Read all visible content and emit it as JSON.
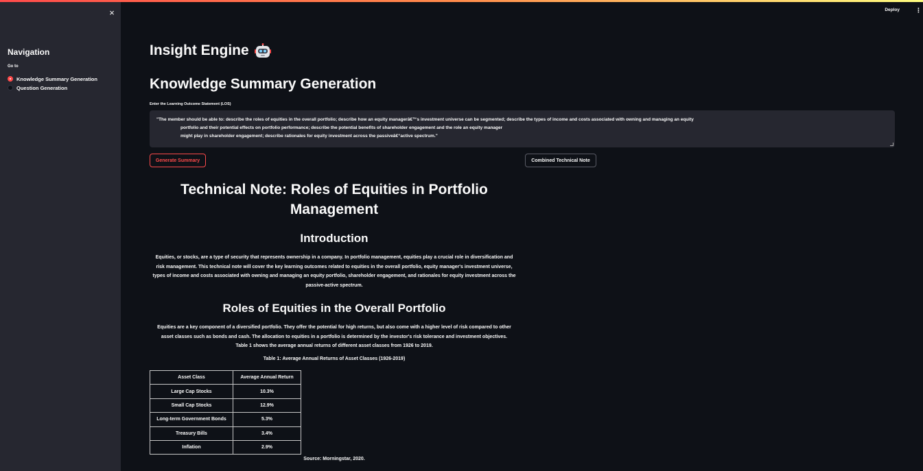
{
  "sidebar": {
    "close_glyph": "×",
    "title": "Navigation",
    "goto_label": "Go to",
    "options": [
      {
        "label": "Knowledge Summary Generation",
        "selected": true
      },
      {
        "label": "Question Generation",
        "selected": false
      }
    ]
  },
  "header": {
    "deploy_label": "Deploy",
    "menu_glyph": "⋮"
  },
  "main": {
    "app_title": "Insight Engine",
    "app_icon": "robot-face-icon",
    "page_title": "Knowledge Summary Generation",
    "los_label": "Enter the Learning Outcome Statement (LOS)",
    "los_lines": [
      "\"The member should be able to: describe the roles of equities in the overall portfolio; describe how an equity managerâ€™s investment universe can be segmented; describe the types of income and costs associated with owning and managing an equity",
      "portfolio and their potential effects on portfolio performance; describe the potential benefits of shareholder engagement and the role an equity manager",
      "might play in shareholder engagement; describe rationales for equity investment across the passiveâ€“active spectrum.\""
    ],
    "generate_button": "Generate Summary",
    "combined_button": "Combined Technical Note"
  },
  "note": {
    "title": "Technical Note: Roles of Equities in Portfolio Management",
    "intro_heading": "Introduction",
    "intro_text": "Equities, or stocks, are a type of security that represents ownership in a company. In portfolio management, equities play a crucial role in diversification and risk management. This technical note will cover the key learning outcomes related to equities in the overall portfolio, equity manager's investment universe, types of income and costs associated with owning and managing an equity portfolio, shareholder engagement, and rationales for equity investment across the passive-active spectrum.",
    "roles_heading": "Roles of Equities in the Overall Portfolio",
    "roles_text": "Equities are a key component of a diversified portfolio. They offer the potential for high returns, but also come with a higher level of risk compared to other asset classes such as bonds and cash. The allocation to equities in a portfolio is determined by the investor's risk tolerance and investment objectives. Table 1 shows the average annual returns of different asset classes from 1926 to 2019.",
    "table_caption": "Table 1: Average Annual Returns of Asset Classes (1926-2019)",
    "table_headers": [
      "Asset Class",
      "Average Annual Return"
    ],
    "table_rows": [
      [
        "Large Cap Stocks",
        "10.3%"
      ],
      [
        "Small Cap Stocks",
        "12.9%"
      ],
      [
        "Long-term Government Bonds",
        "5.3%"
      ],
      [
        "Treasury Bills",
        "3.4%"
      ],
      [
        "Inflation",
        "2.9%"
      ]
    ],
    "source": "Source: Morningstar, 2020."
  },
  "colors": {
    "accent": "#ff4b4b",
    "background": "#0e1117",
    "sidebar": "#262730"
  }
}
